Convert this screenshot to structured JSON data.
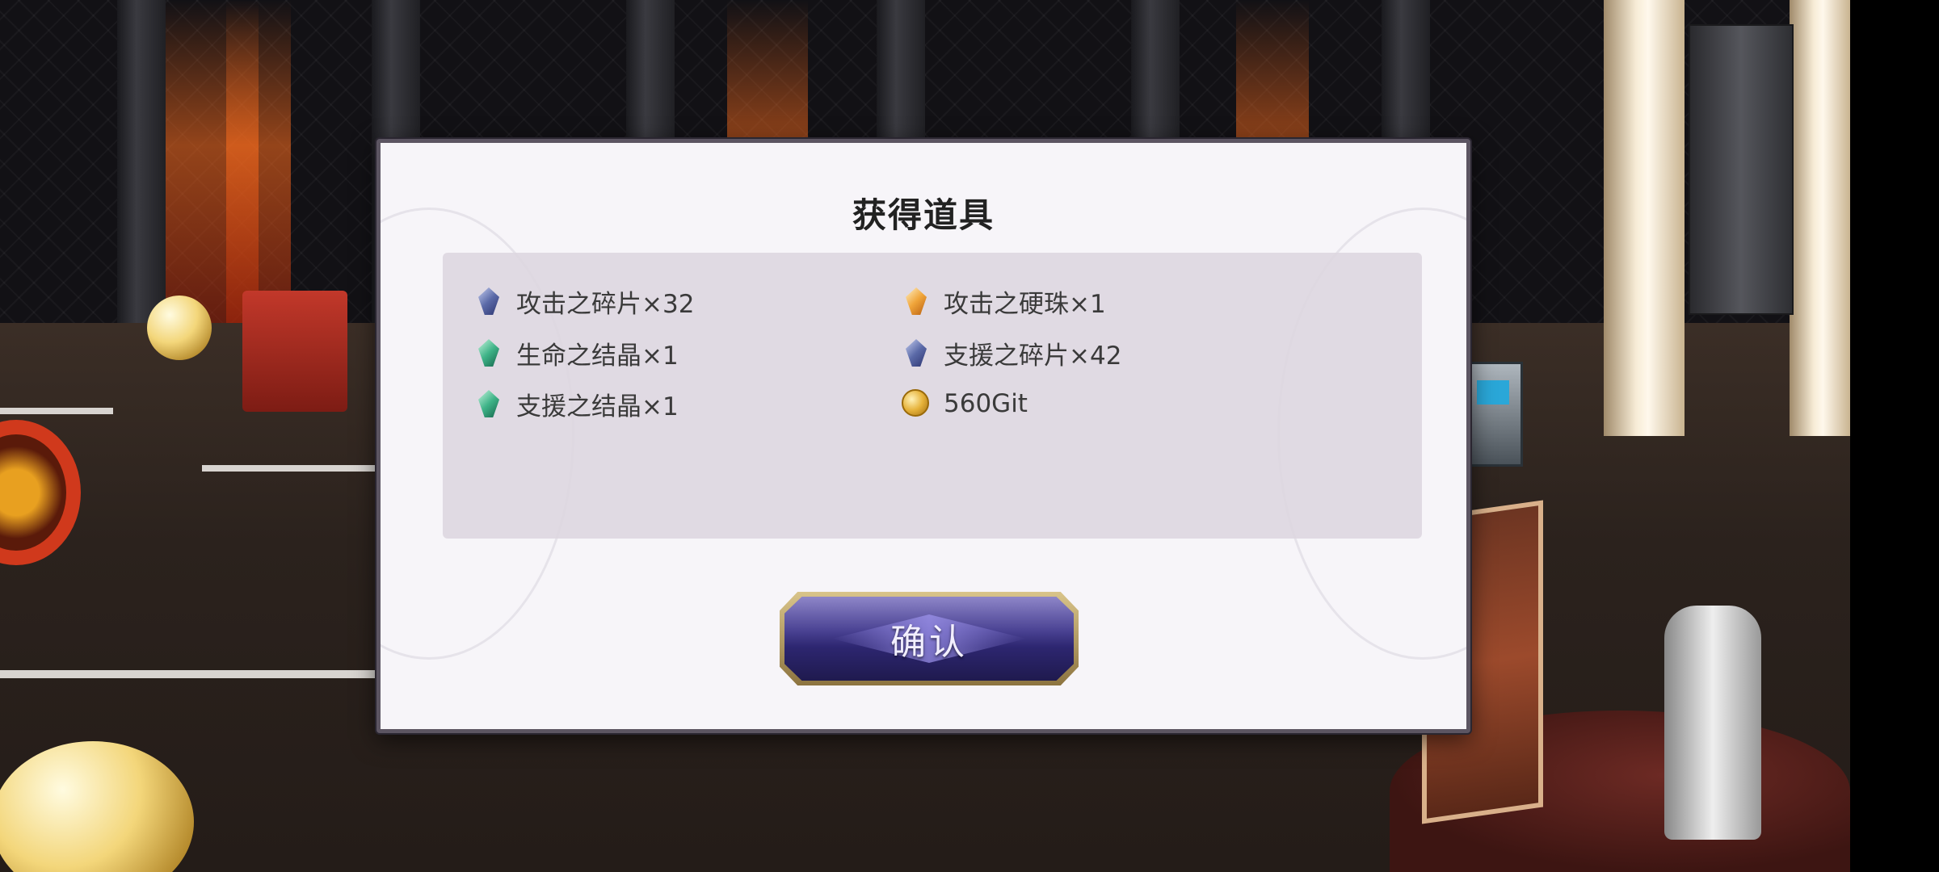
{
  "dialog": {
    "title": "获得道具",
    "confirm_label": "确认"
  },
  "items": [
    {
      "label": "攻击之碎片×32",
      "icon": "blue-gem-icon"
    },
    {
      "label": "攻击之硬珠×1",
      "icon": "orange-gem-icon"
    },
    {
      "label": "生命之结晶×1",
      "icon": "green-gem-icon"
    },
    {
      "label": "支援之碎片×42",
      "icon": "blue-gem-icon"
    },
    {
      "label": "支援之结晶×1",
      "icon": "green-gem-icon"
    },
    {
      "label": "560Git",
      "icon": "gold-coin-icon"
    }
  ],
  "colors": {
    "dialog_bg": "#f7f5f9",
    "panel_bg": "#ddd6df",
    "button_purple": "#2d2670",
    "button_gold": "#d9c48a"
  }
}
